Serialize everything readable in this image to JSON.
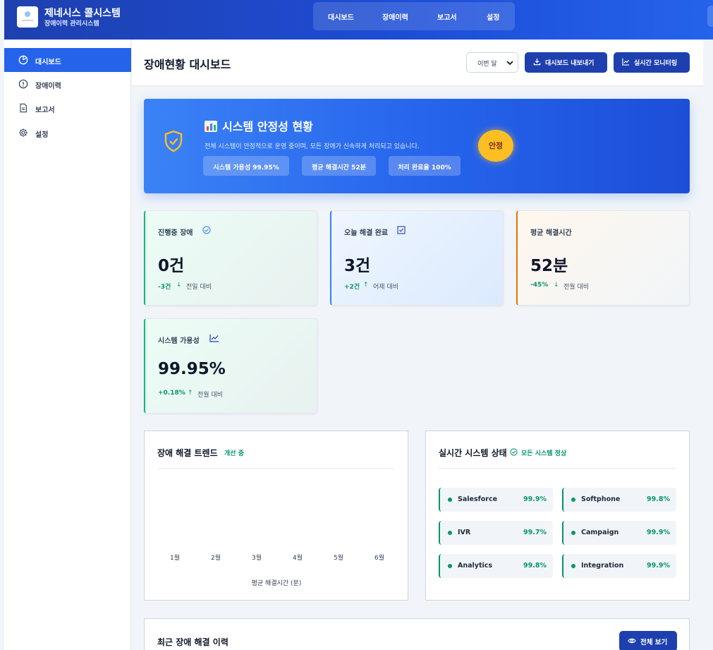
{
  "app": {
    "title": "제네시스 콜시스템",
    "subtitle": "장애이력 관리시스템"
  },
  "topnav": {
    "items": [
      "대시보드",
      "장애이력",
      "보고서",
      "설정"
    ]
  },
  "sidebar": {
    "items": [
      {
        "label": "대시보드",
        "icon": "dashboard-gauge-icon",
        "active": true
      },
      {
        "label": "장애이력",
        "icon": "alert-circle-icon",
        "active": false
      },
      {
        "label": "보고서",
        "icon": "document-icon",
        "active": false
      },
      {
        "label": "설정",
        "icon": "gear-icon",
        "active": false
      }
    ]
  },
  "header": {
    "title": "장애현황 대시보드",
    "period_selected": "이번 달",
    "export_label": "대시보드 내보내기",
    "monitor_label": "실시간 모니터링"
  },
  "hero": {
    "title": "시스템 안정성 현황",
    "description": "전체 시스템이 안정적으로 운영 중이며, 모든 장애가 신속하게 처리되고 있습니다.",
    "chips": [
      "시스템 가용성 99.95%",
      "평균 해결시간 52분",
      "처리 완료율 100%"
    ],
    "status": "안정"
  },
  "kpis": [
    {
      "label": "진행중 장애",
      "value": "0건",
      "delta": "-3건",
      "direction": "down",
      "comparison": "전일 대비",
      "icon": "check-circle-icon"
    },
    {
      "label": "오늘 해결 완료",
      "value": "3건",
      "delta": "+2건",
      "direction": "up",
      "comparison": "어제 대비",
      "icon": "check-square-icon"
    },
    {
      "label": "평균 해결시간",
      "value": "52분",
      "delta": "-45%",
      "direction": "down",
      "comparison": "전월 대비",
      "icon": ""
    },
    {
      "label": "시스템 가용성",
      "value": "99.95%",
      "delta": "+0.18%",
      "direction": "up",
      "comparison": "전월 대비",
      "icon": "trend-up-icon"
    }
  ],
  "trend": {
    "title": "장애 해결 트렌드",
    "tag": "개선 중",
    "months": [
      "1월",
      "2월",
      "3월",
      "4월",
      "5월",
      "6월"
    ],
    "xlabel": "평균 해결시간 (분)"
  },
  "status_panel": {
    "title": "실시간 시스템 상태",
    "tag": "모든 시스템 정상",
    "services": [
      {
        "name": "Salesforce",
        "value": "99.9%"
      },
      {
        "name": "Softphone",
        "value": "99.8%"
      },
      {
        "name": "IVR",
        "value": "99.7%"
      },
      {
        "name": "Campaign",
        "value": "99.9%"
      },
      {
        "name": "Analytics",
        "value": "99.8%"
      },
      {
        "name": "Integration",
        "value": "99.9%"
      }
    ]
  },
  "history": {
    "title": "최근 장애 해결 이력",
    "view_all_label": "전체 보기"
  },
  "colors": {
    "primary": "#1e40af",
    "accent": "#2563eb",
    "success": "#059669",
    "warning": "#fbbf24"
  }
}
